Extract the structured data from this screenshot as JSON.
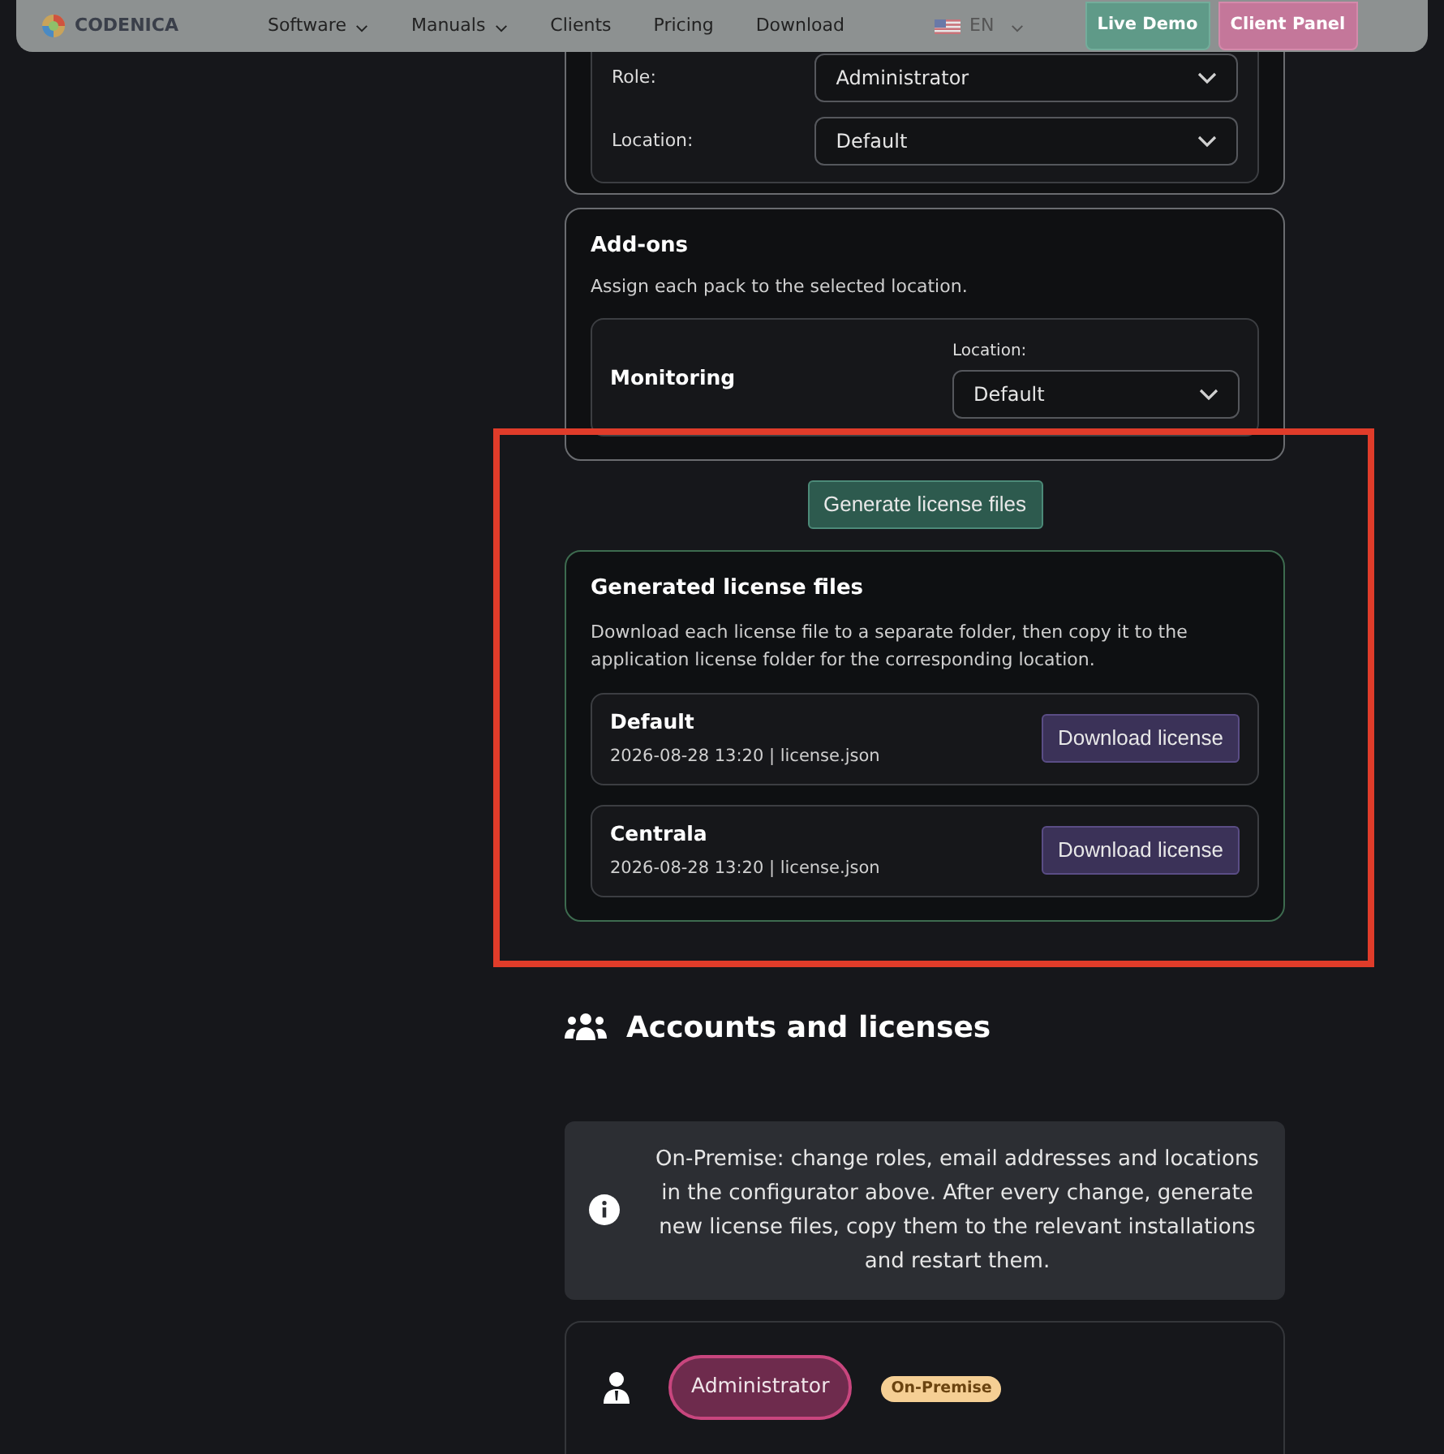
{
  "nav": {
    "brand": "CODENICA",
    "links": [
      {
        "label": "Software",
        "dropdown": true
      },
      {
        "label": "Manuals",
        "dropdown": true
      },
      {
        "label": "Clients",
        "dropdown": false
      },
      {
        "label": "Pricing",
        "dropdown": false
      },
      {
        "label": "Download",
        "dropdown": false
      }
    ],
    "language": "EN",
    "buttons": [
      {
        "label": "Live Demo",
        "kind": "demo"
      },
      {
        "label": "Client Panel",
        "kind": "panel"
      }
    ]
  },
  "account_config": {
    "fields": [
      {
        "label": "Role:",
        "value": "Administrator"
      },
      {
        "label": "Location:",
        "value": "Default"
      }
    ]
  },
  "addons": {
    "title": "Add-ons",
    "description": "Assign each pack to the selected location.",
    "packs": [
      {
        "name": "Monitoring",
        "location_label": "Location:",
        "location": "Default"
      }
    ]
  },
  "generate_button": "Generate license files",
  "generated": {
    "title": "Generated license files",
    "description": "Download each license file to a separate folder, then copy it to the application license folder for the corresponding location.",
    "files": [
      {
        "name": "Default",
        "meta": "2026-08-28 13:20 | license.json",
        "button": "Download license"
      },
      {
        "name": "Centrala",
        "meta": "2026-08-28 13:20 | license.json",
        "button": "Download license"
      }
    ]
  },
  "accounts": {
    "title": "Accounts and licenses",
    "info": "On-Premise: change roles, email addresses and locations in the configurator above. After every change, generate new license files, copy them to the relevant installations and restart them.",
    "users": [
      {
        "role": "Administrator",
        "badge": "On-Premise"
      }
    ]
  }
}
